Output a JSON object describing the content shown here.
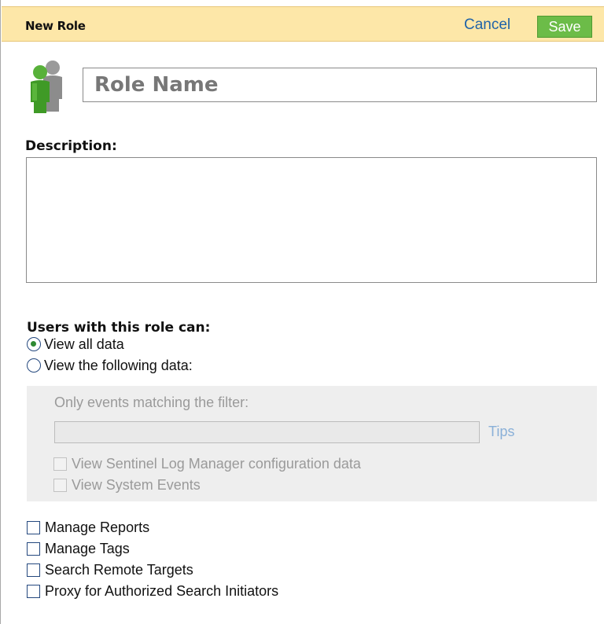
{
  "header": {
    "title": "New Role",
    "cancel_label": "Cancel",
    "save_label": "Save"
  },
  "role": {
    "name_placeholder": "Role Name",
    "name_value": ""
  },
  "description": {
    "label": "Description:",
    "value": ""
  },
  "permissions": {
    "heading": "Users with this role can:",
    "view_options": [
      {
        "label": "View all data",
        "selected": true
      },
      {
        "label": "View the following data:",
        "selected": false
      }
    ],
    "filter": {
      "label": "Only events matching the filter:",
      "value": "",
      "tips_label": "Tips",
      "options": [
        {
          "label": "View Sentinel Log Manager configuration data",
          "checked": false,
          "disabled": true
        },
        {
          "label": "View System Events",
          "checked": false,
          "disabled": true
        }
      ]
    },
    "capabilities": [
      {
        "label": "Manage Reports",
        "checked": false
      },
      {
        "label": "Manage Tags",
        "checked": false
      },
      {
        "label": "Search Remote Targets",
        "checked": false
      },
      {
        "label": "Proxy for Authorized Search Initiators",
        "checked": false
      }
    ]
  },
  "colors": {
    "header_bg": "#fde7a8",
    "link": "#1f63a8",
    "save_bg": "#6cbc48",
    "filter_bg": "#eeeeee"
  },
  "icons": {
    "role": "users-group-icon"
  }
}
